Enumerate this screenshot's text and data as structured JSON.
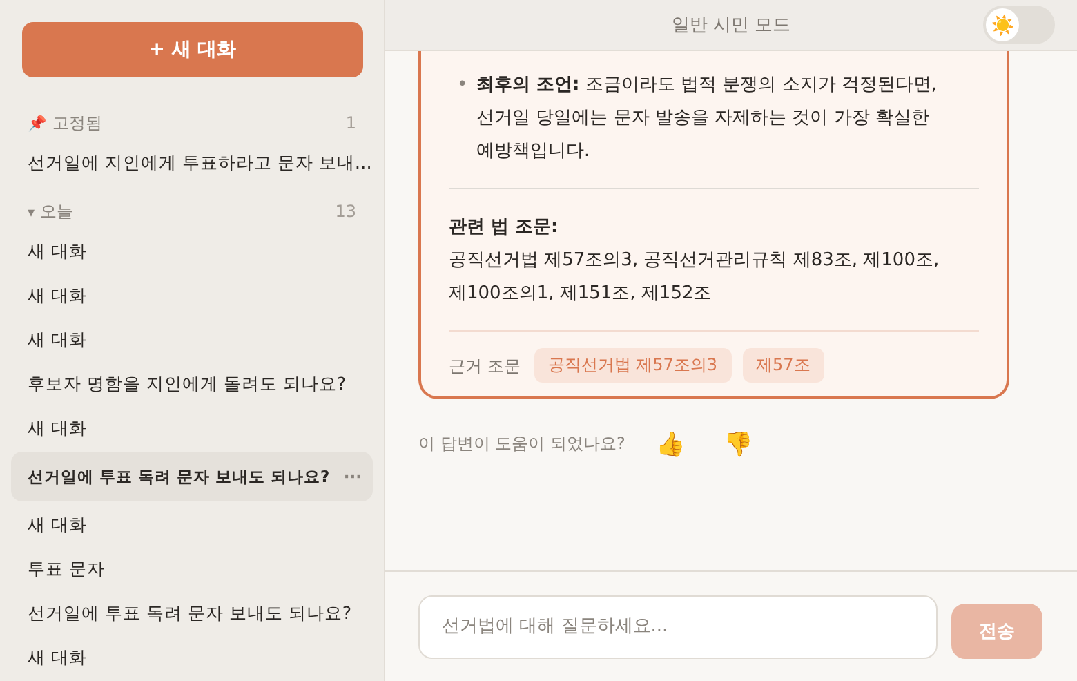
{
  "sidebar": {
    "new_chat_button": "+ 새 대화",
    "sections": [
      {
        "kind": "pinned",
        "icon": "📌",
        "title": "고정됨",
        "count": "1",
        "items": [
          {
            "label": "선거일에 지인에게 투표하라고 문자 보내…",
            "selected": false
          }
        ]
      },
      {
        "kind": "group",
        "icon": "▾",
        "title": "오늘",
        "count": "13",
        "expanded": true,
        "items": [
          {
            "label": "새 대화",
            "selected": false
          },
          {
            "label": "새 대화",
            "selected": false
          },
          {
            "label": "새 대화",
            "selected": false
          },
          {
            "label": "후보자 명함을 지인에게 돌려도 되나요?",
            "selected": false
          },
          {
            "label": "새 대화",
            "selected": false
          },
          {
            "label": "선거일에 투표 독려 문자 보내도 되나요?",
            "selected": true,
            "more": "···"
          },
          {
            "label": "새 대화",
            "selected": false
          },
          {
            "label": "투표 문자",
            "selected": false
          },
          {
            "label": "선거일에 투표 독려 문자 보내도 되나요?",
            "selected": false
          },
          {
            "label": "새 대화",
            "selected": false
          }
        ]
      }
    ]
  },
  "header": {
    "title": "일반 시민 모드",
    "theme_toggle": {
      "on": false,
      "icon": "☀️"
    }
  },
  "answer": {
    "bullet_marker": "•",
    "bullets": [
      "**최후의 조언:** 조금이라도 법적 분쟁의 소지가 걱정된다면, 선거일 당일에는 문자 발송을 자제하는 것이 가장 확실한 예방책입니다."
    ],
    "law_heading": "관련 법 조문:",
    "law_text": "공직선거법 제57조의3, 공직선거관리규칙 제83조, 제100조, 제100조의1, 제151조, 제152조",
    "sources_label": "근거 조문",
    "source_tags": [
      "공직선거법 제57조의3",
      "제57조"
    ]
  },
  "feedback": {
    "question": "이 답변이 도움이 되었나요?",
    "thumbs_up": "👍",
    "thumbs_down": "👎"
  },
  "composer": {
    "placeholder": "선거법에 대해 질문하세요...",
    "send_button": "전송",
    "send_disabled": true
  }
}
